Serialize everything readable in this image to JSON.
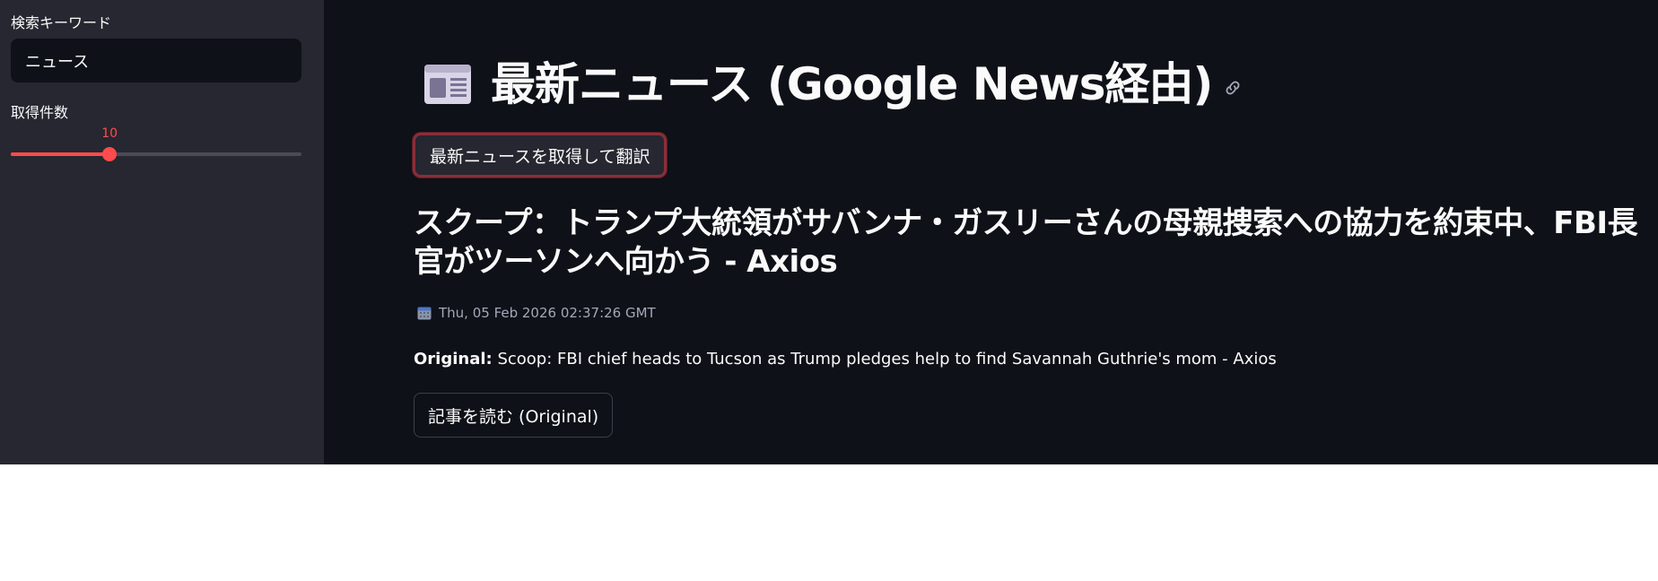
{
  "sidebar": {
    "search_label": "検索キーワード",
    "search_value": "ニュース",
    "count_label": "取得件数",
    "count_value": "10",
    "count_fraction": 0.34,
    "slider_color": "#ff4b4b"
  },
  "main": {
    "title": "最新ニュース (Google News経由)",
    "title_icon": "newspaper-icon",
    "anchor_icon": "link-icon",
    "fetch_button": "最新ニュースを取得して翻訳",
    "article": {
      "headline": "スクープ：トランプ大統領がサバンナ・ガスリーさんの母親捜索への協力を約束中、FBI長官がツーソンへ向かう - Axios",
      "date_icon": "calendar-icon",
      "date": "Thu, 05 Feb 2026 02:37:26 GMT",
      "original_label": "Original:",
      "original_text": " Scoop: FBI chief heads to Tucson as Trump pledges help to find Savannah Guthrie's mom - Axios",
      "read_button": "記事を読む (Original)"
    }
  },
  "colors": {
    "background": "#0e1117",
    "sidebar": "#262730",
    "accent": "#ff4b4b"
  }
}
